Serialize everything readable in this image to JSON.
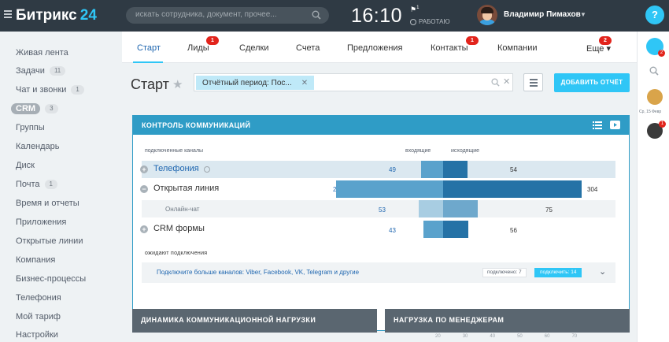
{
  "topbar": {
    "logo": "Битрикс",
    "logo_num": "24",
    "search_placeholder": "искать сотрудника, документ, прочее...",
    "time": "16:10",
    "flag_count": "1",
    "work_status": "РАБОТАЮ",
    "user_name": "Владимир Пимахов",
    "help": "?"
  },
  "sidebar": {
    "items": [
      {
        "label": "Живая лента"
      },
      {
        "label": "Задачи",
        "count": "11"
      },
      {
        "label": "Чат и звонки",
        "count": "1"
      },
      {
        "label": "CRM",
        "count": "3"
      },
      {
        "label": "Группы"
      },
      {
        "label": "Календарь"
      },
      {
        "label": "Диск"
      },
      {
        "label": "Почта",
        "count": "1"
      },
      {
        "label": "Время и отчеты"
      },
      {
        "label": "Приложения"
      },
      {
        "label": "Открытые линии"
      },
      {
        "label": "Компания"
      },
      {
        "label": "Бизнес-процессы"
      },
      {
        "label": "Телефония"
      },
      {
        "label": "Мой тариф"
      },
      {
        "label": "Настройки"
      }
    ]
  },
  "tabs": [
    {
      "label": "Старт"
    },
    {
      "label": "Лиды",
      "badge": "1"
    },
    {
      "label": "Сделки"
    },
    {
      "label": "Счета"
    },
    {
      "label": "Предложения"
    },
    {
      "label": "Контакты",
      "badge": "1"
    },
    {
      "label": "Компании"
    },
    {
      "label": "Еще ▾",
      "badge": "2"
    }
  ],
  "page": {
    "title": "Старт",
    "filter_chip": "Отчётный период: Пос...",
    "add_report": "ДОБАВИТЬ ОТЧЁТ"
  },
  "widget": {
    "title": "КОНТРОЛЬ КОММУНИКАЦИЙ",
    "col_channels": "подключенные каналы",
    "col_in": "входящие",
    "col_out": "исходящие",
    "rows": [
      {
        "label": "Телефония",
        "in": 49,
        "out": 54
      },
      {
        "label": "Открытая линия",
        "in": 235,
        "out": 304
      },
      {
        "label": "Онлайн-чат",
        "in": 53,
        "out": 75
      },
      {
        "label": "CRM формы",
        "in": 43,
        "out": 56
      }
    ],
    "waiting_label": "ожидают подключения",
    "connect_link": "Подключите больше каналов: Viber, Facebook, VK, Telegram и другие",
    "connected": "подключено: 7",
    "connect_btn": "подключить: 14"
  },
  "bottom_panels": [
    {
      "title": "ДИНАМИКА КОММУНИКАЦИОННОЙ НАГРУЗКИ"
    },
    {
      "title": "НАГРУЗКА ПО МЕНЕДЖЕРАМ",
      "ticks": [
        "20",
        "30",
        "40",
        "50",
        "60",
        "70"
      ]
    }
  ],
  "rightbar": {
    "notif_count": "2",
    "date": "Ср, 15 Февр",
    "badge2": "1"
  },
  "colors": {
    "accent": "#2fc6f6",
    "topbar": "#2f3a44",
    "widget_head": "#2f9cc6",
    "bar_in": "#5aa2cc",
    "bar_out": "#2572a6",
    "badge": "#e2241c"
  }
}
